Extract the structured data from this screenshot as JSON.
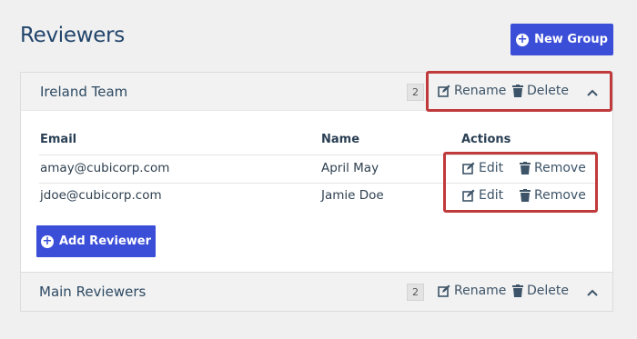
{
  "page": {
    "title": "Reviewers"
  },
  "toolbar": {
    "new_group_label": "New Group"
  },
  "groups": [
    {
      "name": "Ireland Team",
      "count": "2",
      "rename_label": "Rename",
      "delete_label": "Delete",
      "expanded": true,
      "table": {
        "headers": [
          "Email",
          "Name",
          "Actions"
        ],
        "rows": [
          {
            "email": "amay@cubicorp.com",
            "name": "April May",
            "edit": "Edit",
            "remove": "Remove"
          },
          {
            "email": "jdoe@cubicorp.com",
            "name": "Jamie Doe",
            "edit": "Edit",
            "remove": "Remove"
          }
        ]
      },
      "add_reviewer_label": "Add Reviewer"
    },
    {
      "name": "Main Reviewers",
      "count": "2",
      "rename_label": "Rename",
      "delete_label": "Delete",
      "expanded": false
    }
  ],
  "icons": [
    "plus-circle-icon",
    "edit-icon",
    "trash-icon",
    "chevron-up-icon"
  ],
  "colors": {
    "primary": "#3b4ed8",
    "highlight": "#c0393b",
    "title": "#22456b"
  }
}
